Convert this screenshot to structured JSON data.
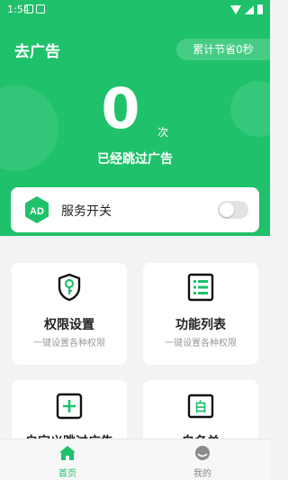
{
  "status_bar": {
    "time": "1:54"
  },
  "header": {
    "app_title": "去广告",
    "saved_time_label": "累计节省0秒",
    "skip_count": "0",
    "skip_unit": "次",
    "skip_label": "已经跳过广告"
  },
  "service_switch": {
    "label": "服务开关",
    "enabled": false
  },
  "cards": [
    {
      "title": "权限设置",
      "subtitle": "一键设置各种权限",
      "icon": "key-shield-icon"
    },
    {
      "title": "功能列表",
      "subtitle": "一键设置各种权限",
      "icon": "list-icon"
    },
    {
      "title": "自定义跳过广告",
      "icon": "plus-icon"
    },
    {
      "title": "白名单",
      "icon": "whitelist-icon",
      "icon_text": "白"
    }
  ],
  "tabbar": {
    "items": [
      {
        "label": "首页",
        "icon": "home-icon",
        "active": true
      },
      {
        "label": "我的",
        "icon": "profile-icon",
        "active": false
      }
    ]
  },
  "colors": {
    "primary": "#1fc16b",
    "background": "#f2f3f5",
    "inactive": "#888888"
  }
}
